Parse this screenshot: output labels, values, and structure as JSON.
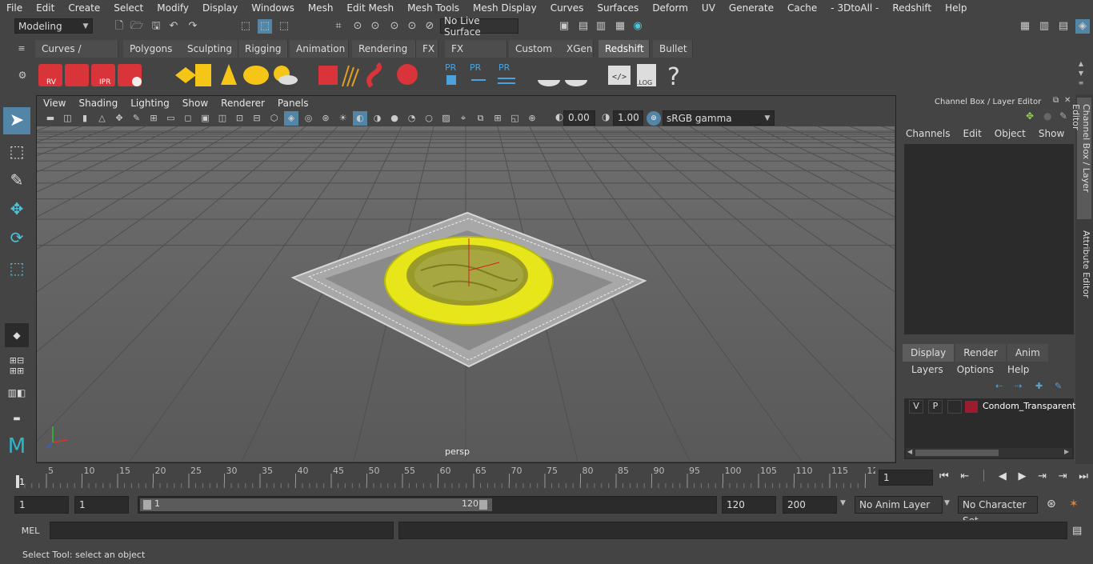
{
  "menubar": [
    "File",
    "Edit",
    "Create",
    "Select",
    "Modify",
    "Display",
    "Windows",
    "Mesh",
    "Edit Mesh",
    "Mesh Tools",
    "Mesh Display",
    "Curves",
    "Surfaces",
    "Deform",
    "UV",
    "Generate",
    "Cache",
    "- 3DtoAll -",
    "Redshift",
    "Help"
  ],
  "status": {
    "mode": "Modeling",
    "live_surface": "No Live Surface"
  },
  "shelf_tabs": [
    {
      "label": "Curves / Surfaces",
      "active": false
    },
    {
      "label": "Polygons",
      "active": false
    },
    {
      "label": "Sculpting",
      "active": false
    },
    {
      "label": "Rigging",
      "active": false
    },
    {
      "label": "Animation",
      "active": false
    },
    {
      "label": "Rendering",
      "active": false
    },
    {
      "label": "FX",
      "active": false
    },
    {
      "label": "FX Caching",
      "active": false
    },
    {
      "label": "Custom",
      "active": false
    },
    {
      "label": "XGen",
      "active": false
    },
    {
      "label": "Redshift",
      "active": true
    },
    {
      "label": "Bullet",
      "active": false
    }
  ],
  "shelf_icons": {
    "rv": "RV",
    "ipr": "IPR",
    "pr": "PR",
    "log": ".LOG",
    "help": "?"
  },
  "viewport": {
    "menu": [
      "View",
      "Shading",
      "Lighting",
      "Show",
      "Renderer",
      "Panels"
    ],
    "exposure": "0.00",
    "gamma": "1.00",
    "colorspace": "sRGB gamma",
    "camera_label": "persp"
  },
  "channel_box": {
    "title": "Channel Box / Layer Editor",
    "menu": [
      "Channels",
      "Edit",
      "Object",
      "Show"
    ],
    "layer_tabs": [
      {
        "label": "Display",
        "active": true
      },
      {
        "label": "Render",
        "active": false
      },
      {
        "label": "Anim",
        "active": false
      }
    ],
    "layer_menu": [
      "Layers",
      "Options",
      "Help"
    ],
    "layer": {
      "v": "V",
      "p": "P",
      "name": "Condom_Transparent_",
      "color": "#9b1b30"
    }
  },
  "sidetabs": {
    "channel": "Channel Box / Layer Editor",
    "attribute": "Attribute Editor"
  },
  "timeline": {
    "ticks": [
      "5",
      "10",
      "15",
      "20",
      "25",
      "30",
      "35",
      "40",
      "45",
      "50",
      "55",
      "60",
      "65",
      "70",
      "75",
      "80",
      "85",
      "90",
      "95",
      "100",
      "105",
      "110",
      "115",
      "12"
    ],
    "start_label": "1",
    "current_frame": "1"
  },
  "range": {
    "start": "1",
    "playback_start": "1",
    "slider_start": "1",
    "slider_end": "120",
    "end": "120",
    "anim_end": "200",
    "anim_layer": "No Anim Layer",
    "char_set": "No Character Set"
  },
  "mel": {
    "label": "MEL"
  },
  "help_line": "Select Tool: select an object",
  "colors": {
    "accent": "#5285a6",
    "bg": "#444444",
    "field": "#2b2b2b",
    "yellow": "#e6e61a"
  }
}
